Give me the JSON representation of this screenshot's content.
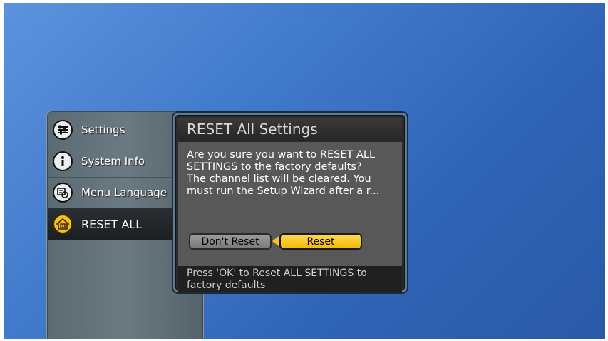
{
  "menu": {
    "items": [
      {
        "label": "Settings",
        "icon": "settings-sliders-icon",
        "active": false
      },
      {
        "label": "System Info",
        "icon": "info-icon",
        "active": false
      },
      {
        "label": "Menu Language",
        "icon": "language-icon",
        "active": false
      },
      {
        "label": "RESET ALL",
        "icon": "home-icon",
        "active": true
      }
    ]
  },
  "dialog": {
    "title": "RESET All Settings",
    "message_line1": "Are you sure you want to RESET ALL SETTINGS to the factory defaults?",
    "message_line2": "The channel list will be cleared. You must run the Setup Wizard after a r...",
    "buttons": {
      "dont_reset": "Don't Reset",
      "reset": "Reset"
    },
    "hint": "Press 'OK' to Reset ALL SETTINGS to factory defaults"
  },
  "colors": {
    "background_blue": "#3f77c9",
    "highlight_gold": "#f6c018",
    "dialog_border": "#5f7d97"
  }
}
